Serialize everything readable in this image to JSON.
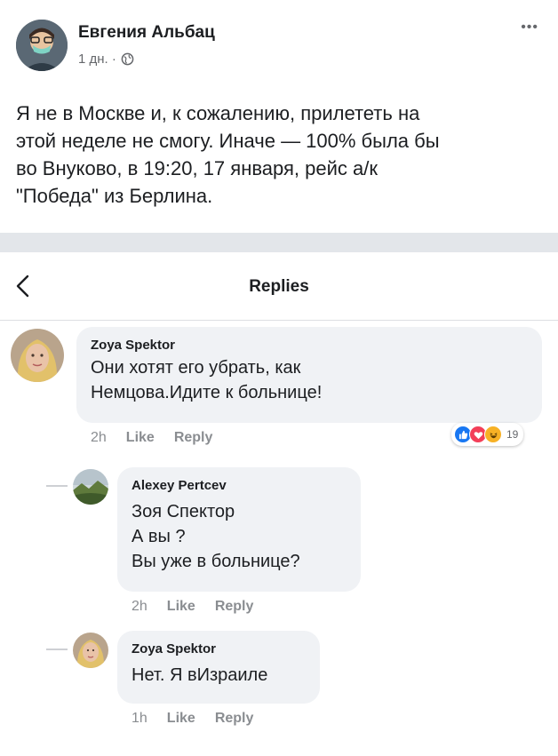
{
  "post": {
    "author": "Евгения Альбац",
    "time": "1 дн. ·",
    "text": "Я не в Москве и, к сожалению, прилететь на\nэтой неделе не смогу. Иначе — 100% была бы\nво Внуково, в 19:20, 17 января, рейс  а/к\n\"Победа\" из Берлина."
  },
  "replies_header": {
    "title": "Replies"
  },
  "comments": [
    {
      "name": "Zoya Spektor",
      "text": "Они хотят его убрать, как\nНемцова.Идите к больнице!",
      "time": "2h",
      "like": "Like",
      "reply": "Reply",
      "reaction_count": "19"
    },
    {
      "name": "Alexey Pertcev",
      "text": "Зоя Спектор\nА вы ?\nВы уже в больнице?",
      "time": "2h",
      "like": "Like",
      "reply": "Reply"
    },
    {
      "name": "Zoya Spektor",
      "text": "Нет. Я вИзраиле",
      "time": "1h",
      "like": "Like",
      "reply": "Reply"
    }
  ],
  "colors": {
    "like_blue": "#1877f2",
    "love_red": "#f33e58",
    "haha_yellow": "#f7b125",
    "bubble_gray": "#f0f2f5",
    "meta_gray": "#8a8d91"
  },
  "icons": [
    "more-icon",
    "globe-icon",
    "back-icon",
    "like-reaction-icon",
    "love-reaction-icon",
    "haha-reaction-icon"
  ]
}
